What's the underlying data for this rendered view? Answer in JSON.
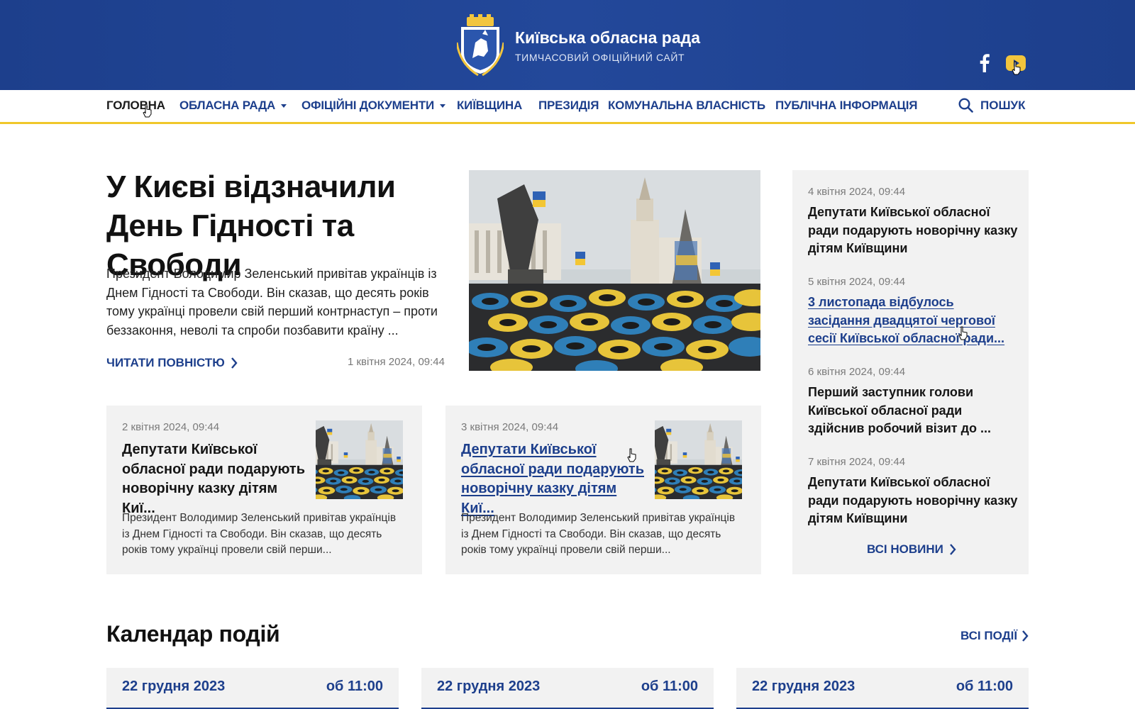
{
  "colors": {
    "primary": "#1d3f8c",
    "accent": "#f0c72a",
    "card_bg": "#f2f2f2"
  },
  "header": {
    "title": "Київська обласна рада",
    "subtitle": "ТИМЧАСОВИЙ ОФІЦІЙНИЙ САЙТ",
    "emblem_icon": "kyiv-oblast-emblem-icon",
    "social": [
      {
        "name": "facebook-icon"
      },
      {
        "name": "youtube-icon"
      }
    ]
  },
  "nav": {
    "items": [
      {
        "label": "ГОЛОВНА",
        "active": true
      },
      {
        "label": "ОБЛАСНА РАДА",
        "dropdown": true
      },
      {
        "label": "ОФІЦІЙНІ ДОКУМЕНТИ",
        "dropdown": true
      },
      {
        "label": "КИЇВЩИНА"
      },
      {
        "label": "ПРЕЗИДІЯ"
      },
      {
        "label": "КОМУНАЛЬНА ВЛАСНІСТЬ"
      },
      {
        "label": "ПУБЛІЧНА ІНФОРМАЦІЯ"
      }
    ],
    "search_label": "ПОШУК"
  },
  "hero": {
    "title": "У Києві відзначили День Гідності та Свободи",
    "text": "Президент Володимир Зеленський привітав українців із Днем Гідності та Свободи. Він сказав, що десять років тому українці провели свій перший контрнаступ – проти беззаконня, неволі та спроби позбавити країну ...",
    "read_more": "ЧИТАТИ ПОВНІСТЮ",
    "date": "1 квітня 2024, 09:44"
  },
  "cards": [
    {
      "date": "2 квітня 2024, 09:44",
      "title": "Депутати Київської обласної ради подарують новорічну казку дітям Киї...",
      "text": "Президент Володимир Зеленський привітав українців із Днем Гідності та Свободи. Він сказав, що десять років тому українці провели свій перши..."
    },
    {
      "date": "3 квітня 2024, 09:44",
      "title": "Депутати Київської обласної ради подарують новорічну казку дітям Киї...",
      "text": "Президент Володимир Зеленський привітав українців із Днем Гідності та Свободи. Він сказав, що десять років тому українці провели свій перши..."
    }
  ],
  "sidebar": {
    "items": [
      {
        "date": "4 квітня 2024, 09:44",
        "title": "Депутати Київської обласної ради подарують новорічну казку дітям Київщини"
      },
      {
        "date": "5 квітня 2024, 09:44",
        "title": "3 листопада відбулось засідання двадцятої чергової сесії Київської обласної ради..."
      },
      {
        "date": "6 квітня 2024, 09:44",
        "title": "Перший заступник голови Київської обласної ради здійснив робочий візит до ..."
      },
      {
        "date": "7 квітня 2024, 09:44",
        "title": "Депутати Київської обласної ради подарують новорічну казку дітям Київщини"
      }
    ],
    "all_news": "ВСІ НОВИНИ"
  },
  "calendar": {
    "title": "Календар подій",
    "all_events": "ВСІ ПОДІЇ",
    "events": [
      {
        "date": "22 грудня 2023",
        "time": "об 11:00"
      },
      {
        "date": "22 грудня 2023",
        "time": "об 11:00"
      },
      {
        "date": "22 грудня 2023",
        "time": "об 11:00"
      }
    ]
  }
}
